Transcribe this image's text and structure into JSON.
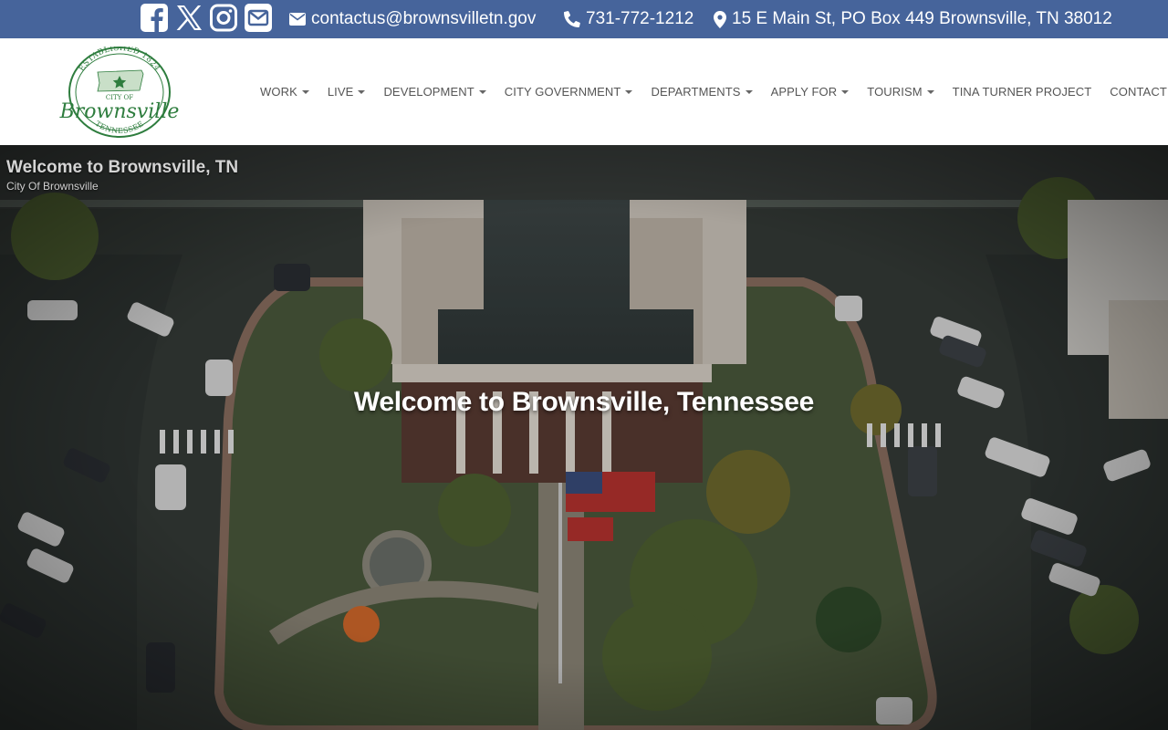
{
  "topbar": {
    "social": [
      "facebook-icon",
      "x-twitter-icon",
      "instagram-icon",
      "envelope-icon"
    ],
    "email": "contactus@brownsvilletn.gov",
    "phone": "731-772-1212",
    "address": "15 E Main St, PO Box 449 Brownsville, TN 38012",
    "bg_color": "#46649b"
  },
  "logo": {
    "established": "ESTABLISHED 1824",
    "city_of": "CITY OF",
    "name": "Brownsville",
    "state": "TENNESSEE",
    "color": "#2e7d3e"
  },
  "nav": {
    "items": [
      {
        "label": "WORK",
        "dropdown": true
      },
      {
        "label": "LIVE",
        "dropdown": true
      },
      {
        "label": "DEVELOPMENT",
        "dropdown": true
      },
      {
        "label": "CITY GOVERNMENT",
        "dropdown": true
      },
      {
        "label": "DEPARTMENTS",
        "dropdown": true
      },
      {
        "label": "APPLY FOR",
        "dropdown": true
      },
      {
        "label": "TOURISM",
        "dropdown": true
      },
      {
        "label": "TINA TURNER PROJECT",
        "dropdown": false
      },
      {
        "label": "CONTACT",
        "dropdown": false
      }
    ]
  },
  "hero": {
    "caption_title": "Welcome to Brownsville, TN",
    "caption_subtitle": "City Of Brownsville",
    "headline": "Welcome to Brownsville, Tennessee"
  }
}
